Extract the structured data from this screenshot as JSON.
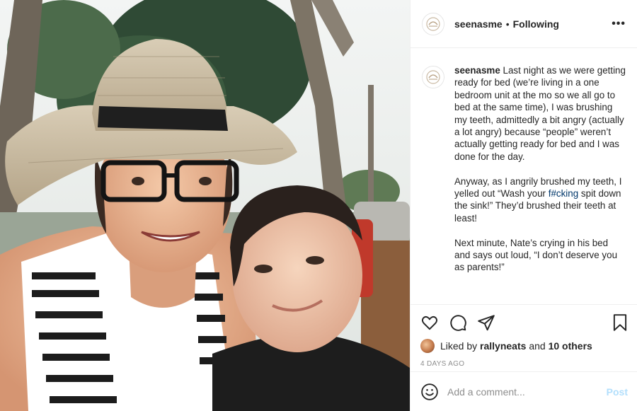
{
  "post": {
    "username": "seenasme",
    "separator": "•",
    "follow_status": "Following",
    "more_icon": "more-horizontal-icon",
    "avatar_icon": "logo-avatar"
  },
  "caption": {
    "username": "seenasme",
    "para1": "Last night as we were getting ready for bed (we’re living in a one bedroom unit at the mo so we all go to bed at the same time), I was brushing my teeth, admittedly a bit angry (actually a lot angry) because “people” weren’t actually getting ready for bed and I was done for the day.",
    "para2_a": "Anyway, as I angrily brushed my teeth, I yelled out “Wash your",
    "para2_tag": "f#cking",
    "para2_b": "spit down the sink!” They’d brushed their teeth at least!",
    "para3": "Next minute, Nate’s crying in his bed and says out loud, “I don’t deserve you as parents!”"
  },
  "actions": {
    "icons": [
      "heart-icon",
      "comment-icon",
      "share-icon",
      "bookmark-icon"
    ],
    "liked_by_prefix": "Liked by",
    "liked_by_user": "rallyneats",
    "and": "and",
    "others": "10 others",
    "timestamp": "4 DAYS AGO"
  },
  "comment": {
    "placeholder": "Add a comment...",
    "post_label": "Post",
    "emoji_icon": "smile-icon"
  },
  "colors": {
    "link": "#00376b",
    "post_disabled": "#b2dffc",
    "muted": "#8e8e8e",
    "border": "#efefef"
  }
}
